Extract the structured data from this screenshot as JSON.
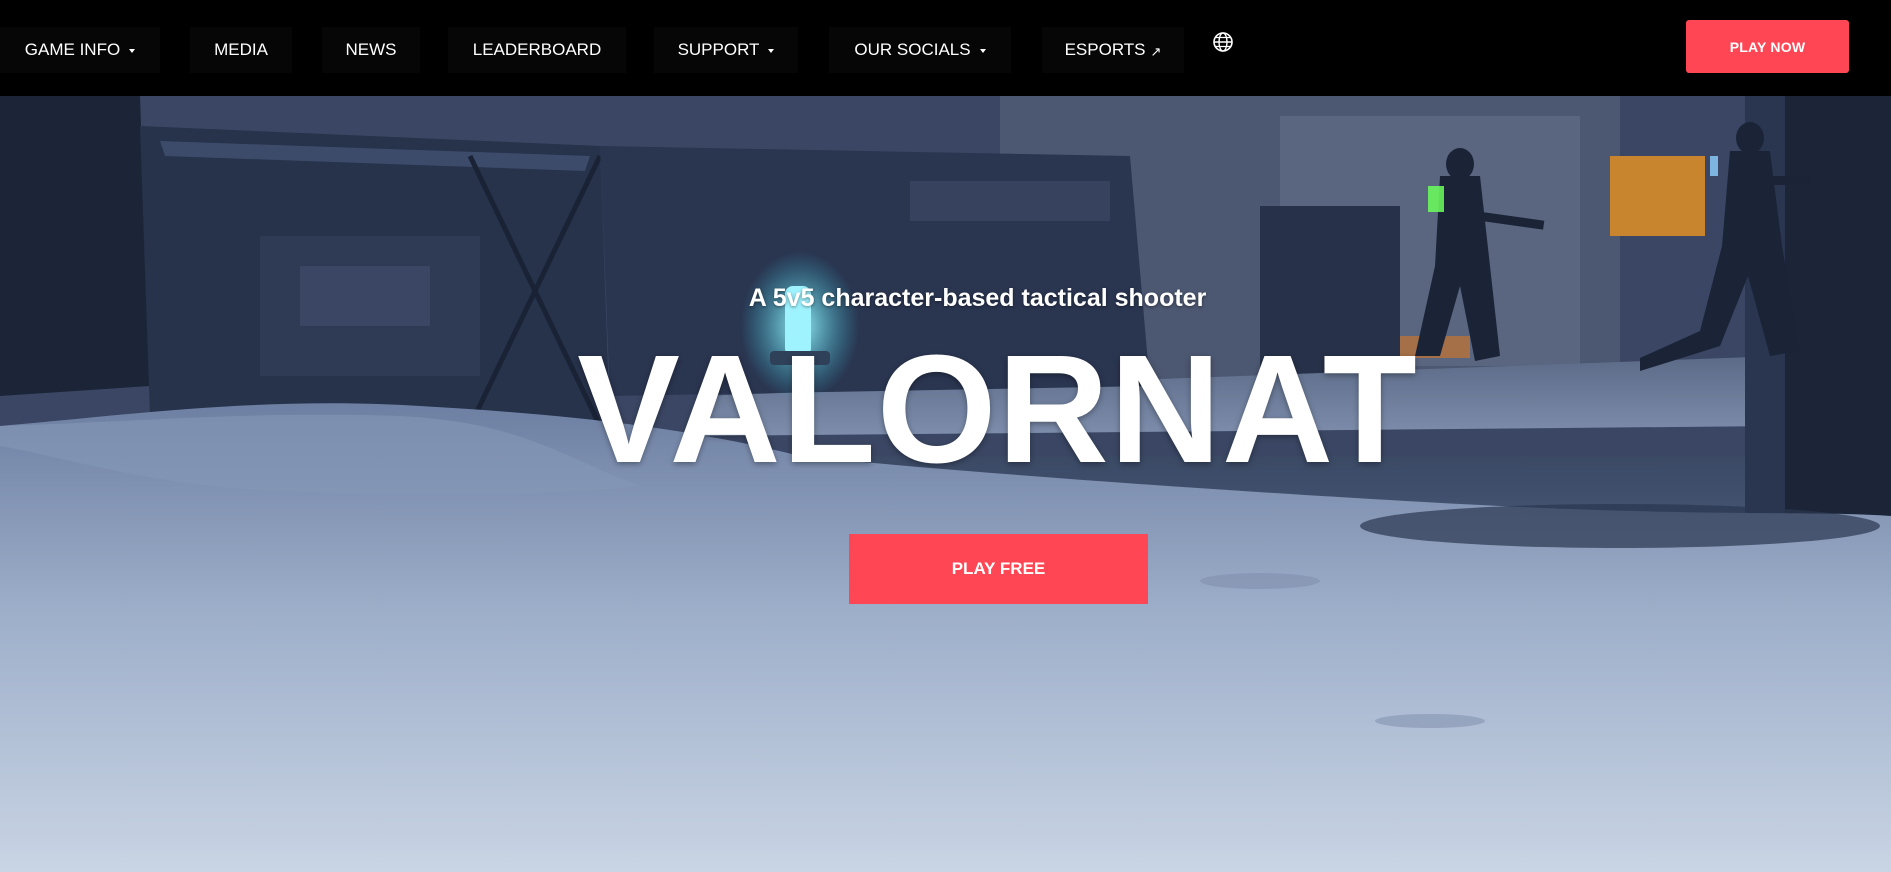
{
  "nav": {
    "items": [
      {
        "label": "GAME INFO",
        "dropdown": true,
        "external": false
      },
      {
        "label": "MEDIA",
        "dropdown": false,
        "external": false
      },
      {
        "label": "NEWS",
        "dropdown": false,
        "external": false
      },
      {
        "label": "LEADERBOARD",
        "dropdown": false,
        "external": false
      },
      {
        "label": "SUPPORT",
        "dropdown": true,
        "external": false
      },
      {
        "label": "OUR SOCIALS",
        "dropdown": true,
        "external": false
      },
      {
        "label": "ESPORTS",
        "dropdown": false,
        "external": true
      }
    ],
    "language_icon": "globe-icon",
    "cta_label": "PLAY NOW"
  },
  "hero": {
    "subtitle": "A 5v5 character-based tactical shooter",
    "title": "VALORNAT",
    "cta_label": "PLAY FREE"
  },
  "colors": {
    "accent": "#ff4655",
    "nav_background": "#000000",
    "text": "#ffffff"
  }
}
